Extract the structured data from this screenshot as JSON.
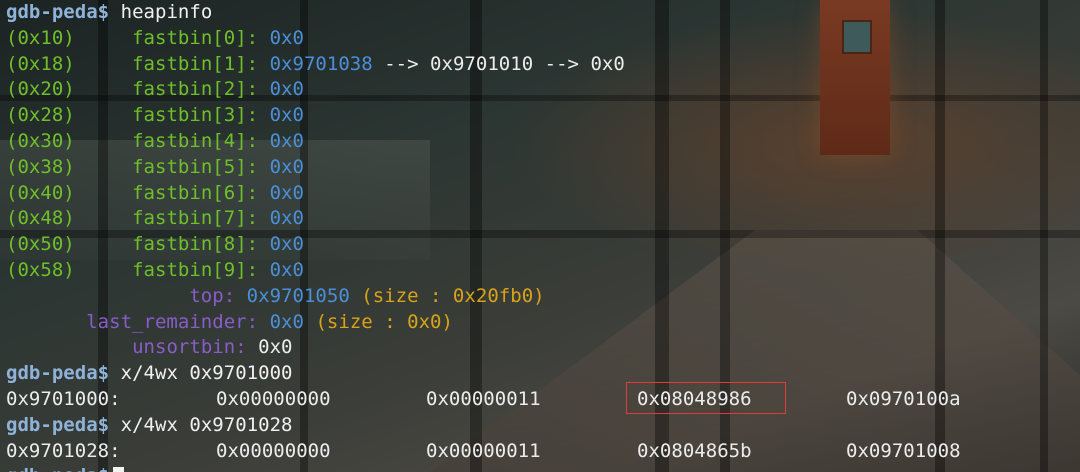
{
  "prompt": "gdb-peda$",
  "commands": {
    "heapinfo": "heapinfo",
    "x1": "x/4wx 0x9701000",
    "x2": "x/4wx 0x9701028"
  },
  "fastbins": [
    {
      "size": "(0x10)",
      "label": "fastbin[0]:",
      "value": "0x0",
      "chain": ""
    },
    {
      "size": "(0x18)",
      "label": "fastbin[1]:",
      "value": "0x9701038",
      "chain": "--> 0x9701010 --> 0x0"
    },
    {
      "size": "(0x20)",
      "label": "fastbin[2]:",
      "value": "0x0",
      "chain": ""
    },
    {
      "size": "(0x28)",
      "label": "fastbin[3]:",
      "value": "0x0",
      "chain": ""
    },
    {
      "size": "(0x30)",
      "label": "fastbin[4]:",
      "value": "0x0",
      "chain": ""
    },
    {
      "size": "(0x38)",
      "label": "fastbin[5]:",
      "value": "0x0",
      "chain": ""
    },
    {
      "size": "(0x40)",
      "label": "fastbin[6]:",
      "value": "0x0",
      "chain": ""
    },
    {
      "size": "(0x48)",
      "label": "fastbin[7]:",
      "value": "0x0",
      "chain": ""
    },
    {
      "size": "(0x50)",
      "label": "fastbin[8]:",
      "value": "0x0",
      "chain": ""
    },
    {
      "size": "(0x58)",
      "label": "fastbin[9]:",
      "value": "0x0",
      "chain": ""
    }
  ],
  "top": {
    "label": "top:",
    "value": "0x9701050",
    "size": "(size : 0x20fb0)"
  },
  "last_remainder": {
    "label": "last_remainder:",
    "value": "0x0",
    "size": "(size : 0x0)"
  },
  "unsortbin": {
    "label": "unsortbin:",
    "value": "0x0"
  },
  "dump1": {
    "addr": "0x9701000:",
    "w0": "0x00000000",
    "w1": "0x00000011",
    "w2": "0x08048986",
    "w3": "0x0970100a"
  },
  "dump2": {
    "addr": "0x9701028:",
    "w0": "0x00000000",
    "w1": "0x00000011",
    "w2": "0x0804865b",
    "w3": "0x09701008"
  },
  "colors": {
    "prompt": "#8fb2d8",
    "fastbin_text": "#6fbf2a",
    "address": "#4a8fd8",
    "size_info": "#d9a318",
    "highlight_box": "#e23a3a"
  }
}
